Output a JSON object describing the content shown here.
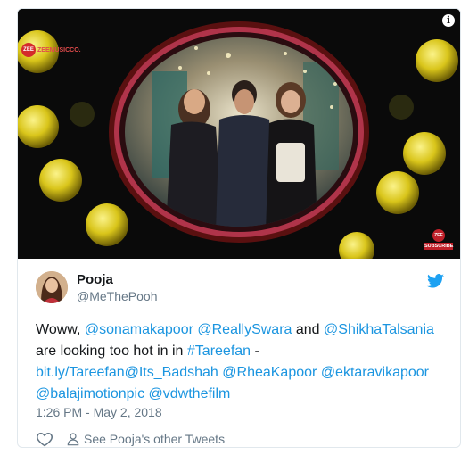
{
  "media": {
    "brand_logo_text": "ZEEMUSICCO.",
    "brand_mark_text": "ZEE",
    "info_icon": "i",
    "subscribe_mark_text": "ZEE",
    "subscribe_label": "SUBSCRIBE",
    "icons": [
      "info-icon",
      "brand-logo",
      "subscribe-badge"
    ]
  },
  "tweet": {
    "display_name": "Pooja",
    "handle": "@MeThePooh",
    "text": {
      "t1": "Woww, ",
      "m1": "@sonamakapoor",
      "t2": " ",
      "m2": "@ReallySwara",
      "t3": " and ",
      "m3": "@ShikhaTalsania",
      "t4": " are looking too hot in in ",
      "h1": "#Tareefan",
      "t5": " - ",
      "l1": "bit.ly/Tareefan",
      "m4": "@Its_Badshah",
      "t6": " ",
      "m5": "@RheaKapoor",
      "t7": " ",
      "m6": "@ektaravikapoor",
      "t8": " ",
      "m7": "@balajimotionpic",
      "t9": " ",
      "m8": "@vdwthefilm"
    },
    "timestamp": "1:26 PM - May 2, 2018",
    "other_tweets_label": "See Pooja's other Tweets"
  },
  "colors": {
    "link": "#1b95e0",
    "text": "#14171a",
    "muted": "#657786",
    "twitter_bird": "#1da1f2",
    "border": "#e1e8ed"
  },
  "icons": [
    "twitter-bird-icon",
    "heart-icon",
    "person-icon"
  ]
}
